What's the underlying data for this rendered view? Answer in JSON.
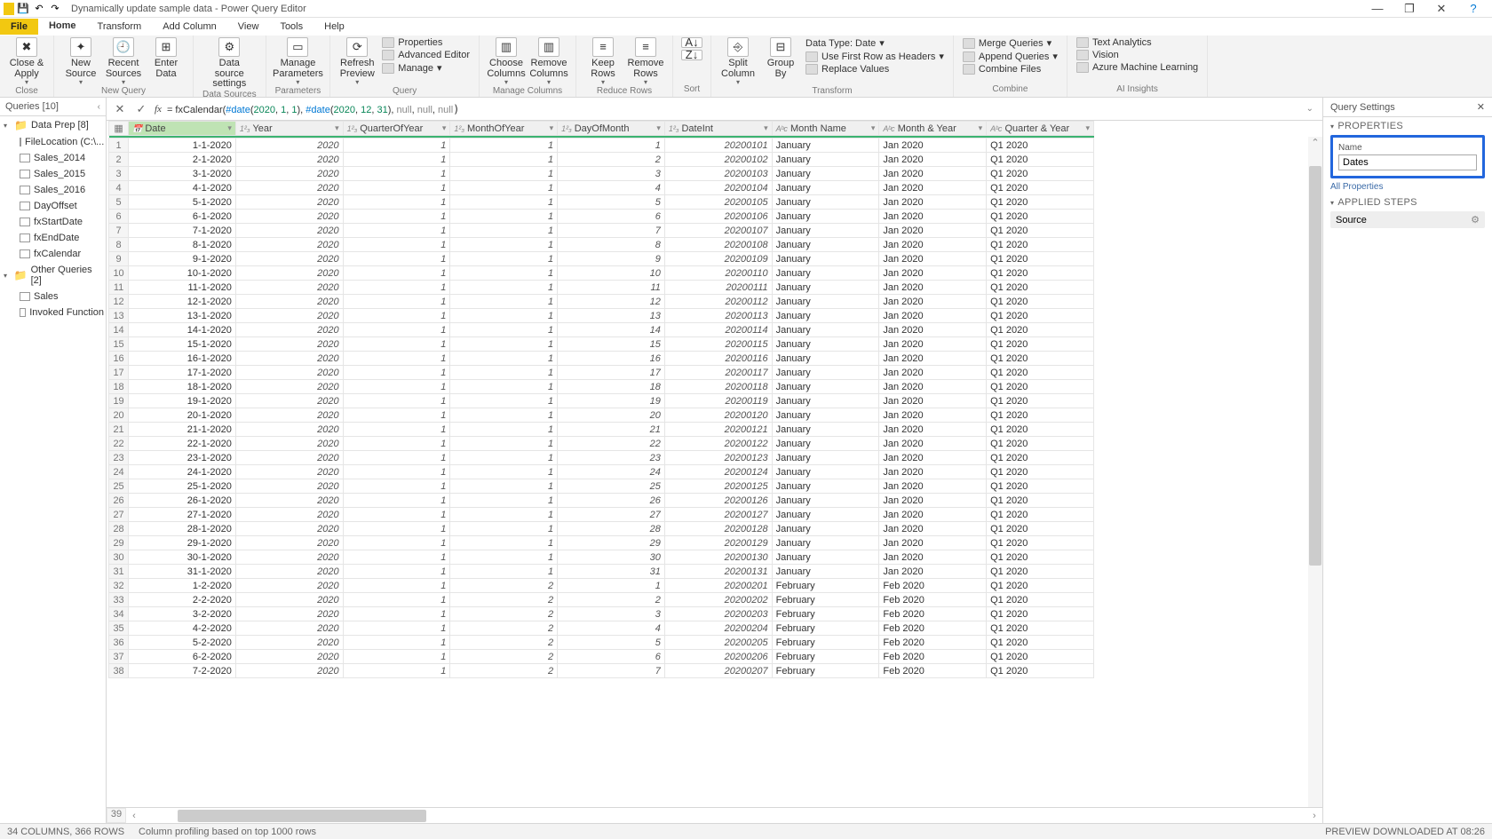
{
  "window": {
    "title": "Dynamically update sample data - Power Query Editor",
    "minimize": "—",
    "maximize": "❐",
    "close": "✕",
    "help": "?"
  },
  "tabs": {
    "file": "File",
    "home": "Home",
    "transform": "Transform",
    "add": "Add Column",
    "view": "View",
    "tools": "Tools",
    "help": "Help"
  },
  "ribbon": {
    "close": "Close & Apply",
    "new": "New Source",
    "recent": "Recent Sources",
    "enter": "Enter Data",
    "dss": "Data source settings",
    "params": "Manage Parameters",
    "refresh": "Refresh Preview",
    "props": "Properties",
    "adv": "Advanced Editor",
    "manage": "Manage",
    "choose": "Choose Columns",
    "remove": "Remove Columns",
    "keep": "Keep Rows",
    "rrows": "Remove Rows",
    "sort": "Sort",
    "split": "Split Column",
    "group": "Group By",
    "dtype": "Data Type: Date",
    "firstrow": "Use First Row as Headers",
    "replace": "Replace Values",
    "merge": "Merge Queries",
    "append": "Append Queries",
    "combine": "Combine Files",
    "textan": "Text Analytics",
    "vision": "Vision",
    "azure": "Azure Machine Learning",
    "g_close": "Close",
    "g_newq": "New Query",
    "g_ds": "Data Sources",
    "g_params": "Parameters",
    "g_query": "Query",
    "g_cols": "Manage Columns",
    "g_rows": "Reduce Rows",
    "g_sort": "Sort",
    "g_trans": "Transform",
    "g_comb": "Combine",
    "g_ai": "AI Insights"
  },
  "formula": {
    "fx": "fx",
    "cancel": "✕",
    "accept": "✓",
    "prefix": "= fxCalendar(",
    "d1": "#date",
    "p1": "(",
    "n1": "2020",
    "c": ", ",
    "n2": "1",
    "n3": "1",
    "p2": ")",
    "d2": "#date",
    "np": "(",
    "n4": "2020",
    "n5": "12",
    "n6": "31",
    "cp": ")",
    "nl": "null"
  },
  "queries": {
    "header": "Queries [10]",
    "folder1": "Data Prep [8]",
    "items1": [
      "FileLocation (C:\\...",
      "Sales_2014",
      "Sales_2015",
      "Sales_2016",
      "DayOffset",
      "fxStartDate",
      "fxEndDate",
      "fxCalendar"
    ],
    "folder2": "Other Queries [2]",
    "items2": [
      "Sales",
      "Invoked Function"
    ]
  },
  "columns": [
    "Date",
    "Year",
    "QuarterOfYear",
    "MonthOfYear",
    "DayOfMonth",
    "DateInt",
    "Month Name",
    "Month & Year",
    "Quarter & Year"
  ],
  "coltypes": [
    "📅",
    "1²₃",
    "1²₃",
    "1²₃",
    "1²₃",
    "1²₃",
    "Aᵇc",
    "Aᵇc",
    "Aᵇc"
  ],
  "rows": [
    [
      "1-1-2020",
      "2020",
      "1",
      "1",
      "1",
      "20200101",
      "January",
      "Jan 2020",
      "Q1 2020"
    ],
    [
      "2-1-2020",
      "2020",
      "1",
      "1",
      "2",
      "20200102",
      "January",
      "Jan 2020",
      "Q1 2020"
    ],
    [
      "3-1-2020",
      "2020",
      "1",
      "1",
      "3",
      "20200103",
      "January",
      "Jan 2020",
      "Q1 2020"
    ],
    [
      "4-1-2020",
      "2020",
      "1",
      "1",
      "4",
      "20200104",
      "January",
      "Jan 2020",
      "Q1 2020"
    ],
    [
      "5-1-2020",
      "2020",
      "1",
      "1",
      "5",
      "20200105",
      "January",
      "Jan 2020",
      "Q1 2020"
    ],
    [
      "6-1-2020",
      "2020",
      "1",
      "1",
      "6",
      "20200106",
      "January",
      "Jan 2020",
      "Q1 2020"
    ],
    [
      "7-1-2020",
      "2020",
      "1",
      "1",
      "7",
      "20200107",
      "January",
      "Jan 2020",
      "Q1 2020"
    ],
    [
      "8-1-2020",
      "2020",
      "1",
      "1",
      "8",
      "20200108",
      "January",
      "Jan 2020",
      "Q1 2020"
    ],
    [
      "9-1-2020",
      "2020",
      "1",
      "1",
      "9",
      "20200109",
      "January",
      "Jan 2020",
      "Q1 2020"
    ],
    [
      "10-1-2020",
      "2020",
      "1",
      "1",
      "10",
      "20200110",
      "January",
      "Jan 2020",
      "Q1 2020"
    ],
    [
      "11-1-2020",
      "2020",
      "1",
      "1",
      "11",
      "20200111",
      "January",
      "Jan 2020",
      "Q1 2020"
    ],
    [
      "12-1-2020",
      "2020",
      "1",
      "1",
      "12",
      "20200112",
      "January",
      "Jan 2020",
      "Q1 2020"
    ],
    [
      "13-1-2020",
      "2020",
      "1",
      "1",
      "13",
      "20200113",
      "January",
      "Jan 2020",
      "Q1 2020"
    ],
    [
      "14-1-2020",
      "2020",
      "1",
      "1",
      "14",
      "20200114",
      "January",
      "Jan 2020",
      "Q1 2020"
    ],
    [
      "15-1-2020",
      "2020",
      "1",
      "1",
      "15",
      "20200115",
      "January",
      "Jan 2020",
      "Q1 2020"
    ],
    [
      "16-1-2020",
      "2020",
      "1",
      "1",
      "16",
      "20200116",
      "January",
      "Jan 2020",
      "Q1 2020"
    ],
    [
      "17-1-2020",
      "2020",
      "1",
      "1",
      "17",
      "20200117",
      "January",
      "Jan 2020",
      "Q1 2020"
    ],
    [
      "18-1-2020",
      "2020",
      "1",
      "1",
      "18",
      "20200118",
      "January",
      "Jan 2020",
      "Q1 2020"
    ],
    [
      "19-1-2020",
      "2020",
      "1",
      "1",
      "19",
      "20200119",
      "January",
      "Jan 2020",
      "Q1 2020"
    ],
    [
      "20-1-2020",
      "2020",
      "1",
      "1",
      "20",
      "20200120",
      "January",
      "Jan 2020",
      "Q1 2020"
    ],
    [
      "21-1-2020",
      "2020",
      "1",
      "1",
      "21",
      "20200121",
      "January",
      "Jan 2020",
      "Q1 2020"
    ],
    [
      "22-1-2020",
      "2020",
      "1",
      "1",
      "22",
      "20200122",
      "January",
      "Jan 2020",
      "Q1 2020"
    ],
    [
      "23-1-2020",
      "2020",
      "1",
      "1",
      "23",
      "20200123",
      "January",
      "Jan 2020",
      "Q1 2020"
    ],
    [
      "24-1-2020",
      "2020",
      "1",
      "1",
      "24",
      "20200124",
      "January",
      "Jan 2020",
      "Q1 2020"
    ],
    [
      "25-1-2020",
      "2020",
      "1",
      "1",
      "25",
      "20200125",
      "January",
      "Jan 2020",
      "Q1 2020"
    ],
    [
      "26-1-2020",
      "2020",
      "1",
      "1",
      "26",
      "20200126",
      "January",
      "Jan 2020",
      "Q1 2020"
    ],
    [
      "27-1-2020",
      "2020",
      "1",
      "1",
      "27",
      "20200127",
      "January",
      "Jan 2020",
      "Q1 2020"
    ],
    [
      "28-1-2020",
      "2020",
      "1",
      "1",
      "28",
      "20200128",
      "January",
      "Jan 2020",
      "Q1 2020"
    ],
    [
      "29-1-2020",
      "2020",
      "1",
      "1",
      "29",
      "20200129",
      "January",
      "Jan 2020",
      "Q1 2020"
    ],
    [
      "30-1-2020",
      "2020",
      "1",
      "1",
      "30",
      "20200130",
      "January",
      "Jan 2020",
      "Q1 2020"
    ],
    [
      "31-1-2020",
      "2020",
      "1",
      "1",
      "31",
      "20200131",
      "January",
      "Jan 2020",
      "Q1 2020"
    ],
    [
      "1-2-2020",
      "2020",
      "1",
      "2",
      "1",
      "20200201",
      "February",
      "Feb 2020",
      "Q1 2020"
    ],
    [
      "2-2-2020",
      "2020",
      "1",
      "2",
      "2",
      "20200202",
      "February",
      "Feb 2020",
      "Q1 2020"
    ],
    [
      "3-2-2020",
      "2020",
      "1",
      "2",
      "3",
      "20200203",
      "February",
      "Feb 2020",
      "Q1 2020"
    ],
    [
      "4-2-2020",
      "2020",
      "1",
      "2",
      "4",
      "20200204",
      "February",
      "Feb 2020",
      "Q1 2020"
    ],
    [
      "5-2-2020",
      "2020",
      "1",
      "2",
      "5",
      "20200205",
      "February",
      "Feb 2020",
      "Q1 2020"
    ],
    [
      "6-2-2020",
      "2020",
      "1",
      "2",
      "6",
      "20200206",
      "February",
      "Feb 2020",
      "Q1 2020"
    ],
    [
      "7-2-2020",
      "2020",
      "1",
      "2",
      "7",
      "20200207",
      "February",
      "Feb 2020",
      "Q1 2020"
    ]
  ],
  "lastrow": "39",
  "settings": {
    "header": "Query Settings",
    "close": "✕",
    "properties": "PROPERTIES",
    "name": "Name",
    "name_value": "Dates",
    "allprops": "All Properties",
    "applied": "APPLIED STEPS",
    "step1": "Source"
  },
  "status": {
    "left": "34 COLUMNS, 366 ROWS",
    "mid": "Column profiling based on top 1000 rows",
    "right": "PREVIEW DOWNLOADED AT 08:26"
  }
}
